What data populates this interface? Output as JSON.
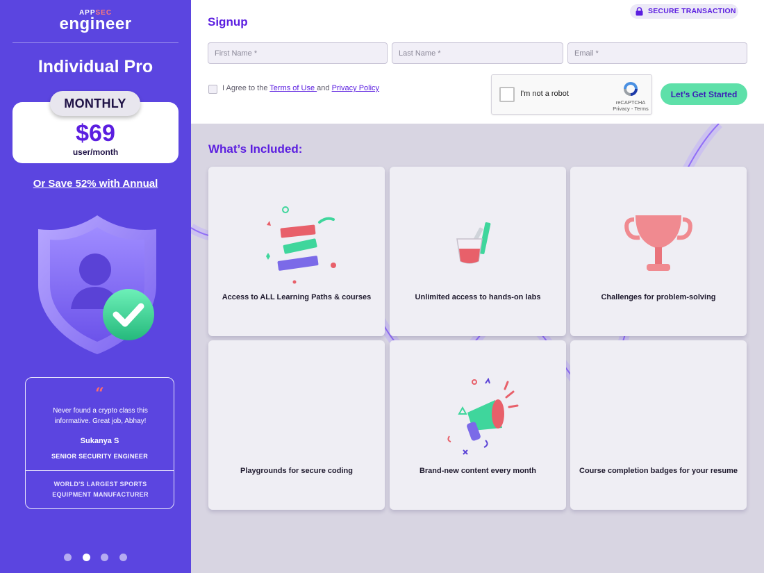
{
  "brand": {
    "logo_top_a": "APP",
    "logo_top_b": "SEC",
    "logo_main": "engineer"
  },
  "plan": {
    "title": "Individual Pro",
    "period": "MONTHLY",
    "price": "$69",
    "unit": "user/month",
    "annual_link": "Or Save 52% with Annual"
  },
  "testimonial": {
    "quote_mark": "“",
    "text": "Never found a crypto class this informative. Great job, Abhay!",
    "author": "Sukanya S",
    "role": "SENIOR SECURITY ENGINEER",
    "company": "WORLD'S LARGEST SPORTS EQUIPMENT MANUFACTURER"
  },
  "carousel": {
    "dot_count": 4,
    "active_index": 1
  },
  "signup": {
    "secure_badge": "SECURE TRANSACTION",
    "title": "Signup",
    "first_name_placeholder": "First Name *",
    "last_name_placeholder": "Last Name *",
    "email_placeholder": "Email *",
    "agree_prefix": "I Agree to the",
    "terms_link": " Terms of Use ",
    "agree_and": "and",
    "privacy_link": " Privacy Policy",
    "recaptcha_label": "I'm not a robot",
    "recaptcha_brand": "reCAPTCHA",
    "recaptcha_links": "Privacy - Terms",
    "submit_label": "Let’s Get Started"
  },
  "included": {
    "title": "What’s Included:",
    "items": [
      {
        "label": "Access to ALL Learning Paths & courses",
        "icon": "books-icon"
      },
      {
        "label": "Unlimited access to hands-on labs",
        "icon": "lab-beaker-icon"
      },
      {
        "label": "Challenges for problem-solving",
        "icon": "trophy-icon"
      },
      {
        "label": "Playgrounds for secure coding",
        "icon": ""
      },
      {
        "label": "Brand-new content every month",
        "icon": "megaphone-icon"
      },
      {
        "label": "Course completion badges for your resume",
        "icon": ""
      }
    ]
  },
  "colors": {
    "sidebar": "#5b45e0",
    "accent": "#5b1ee0",
    "cta": "#5ee0a9",
    "page_bg": "#d8d5e2"
  }
}
